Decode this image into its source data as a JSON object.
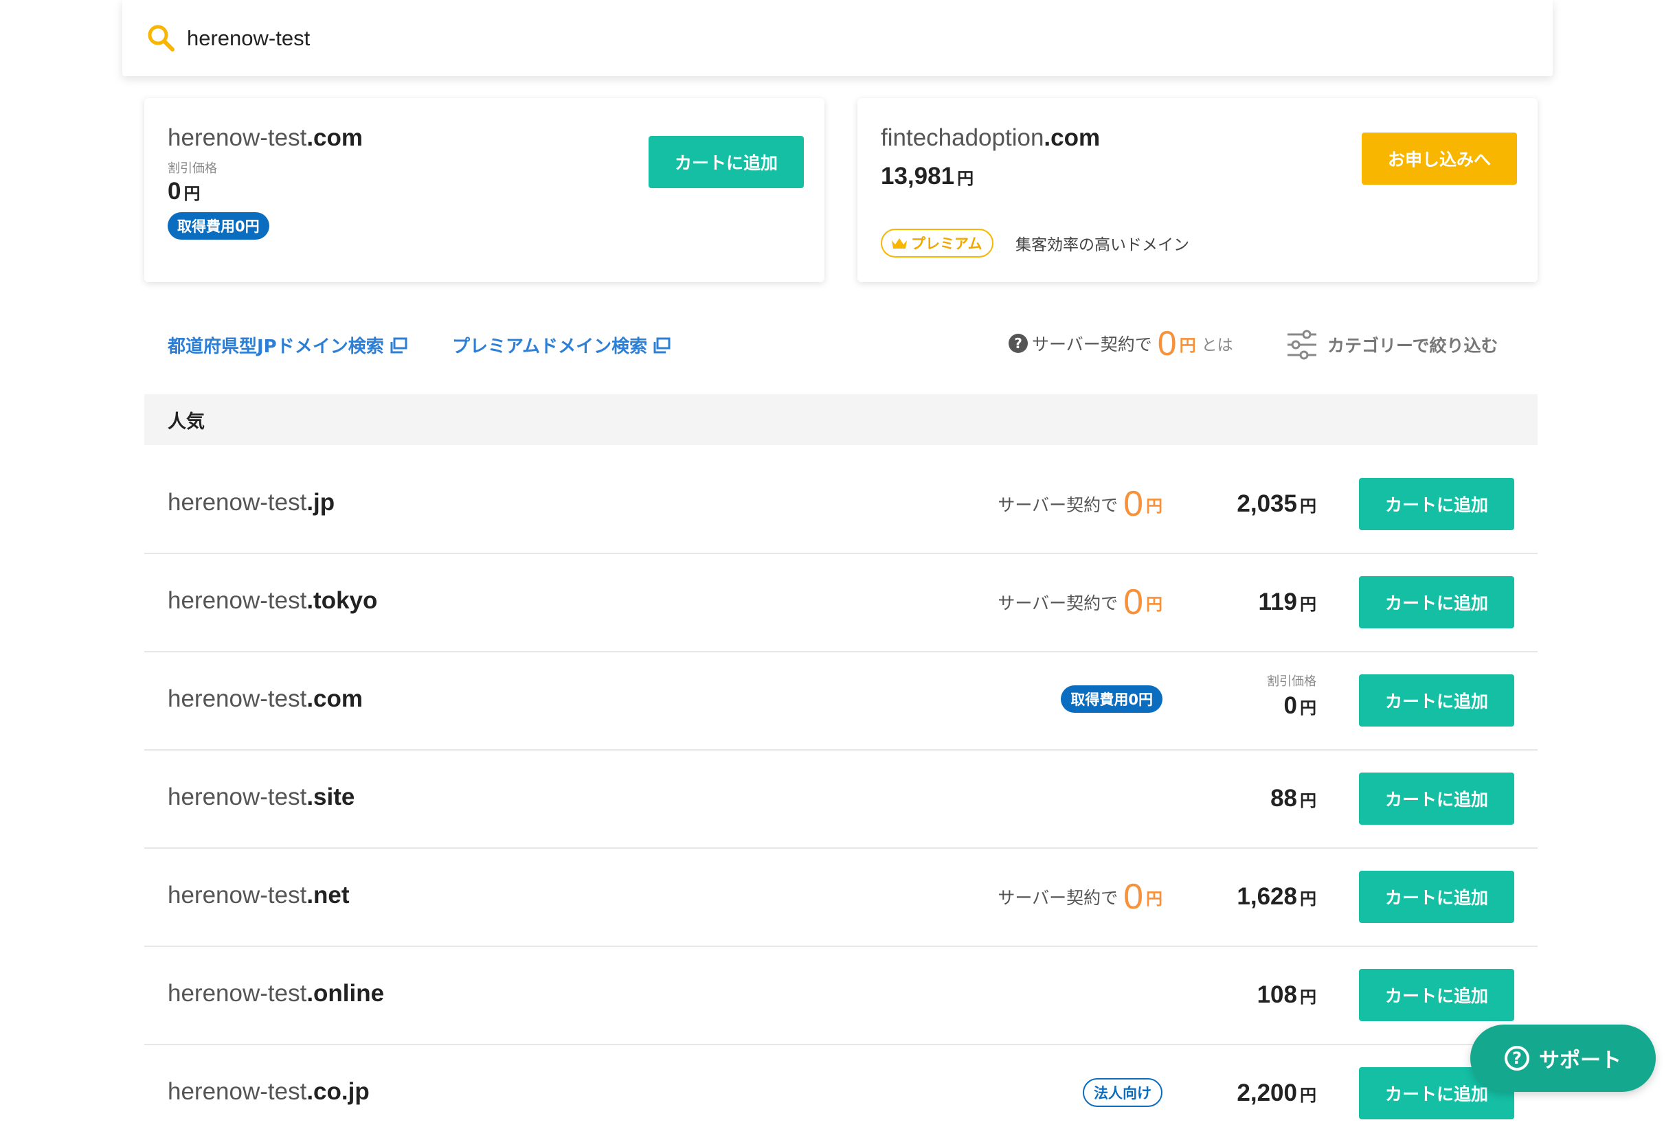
{
  "search": {
    "value": "herenow-test"
  },
  "cards": [
    {
      "domain_name": "herenow-test",
      "domain_tld": ".com",
      "discount_label": "割引価格",
      "price": "0",
      "yen": "円",
      "badge": "取得費用0円",
      "button": "カートに追加"
    },
    {
      "domain_name": "fintechadoption",
      "domain_tld": ".com",
      "price": "13,981",
      "yen": "円",
      "premium_badge": "プレミアム",
      "description": "集客効率の高いドメイン",
      "button": "お申し込みへ"
    }
  ],
  "links": {
    "prefecture": "都道府県型JPドメイン検索",
    "premium": "プレミアムドメイン検索"
  },
  "server_note": {
    "prefix": "サーバー契約で",
    "zero": "0",
    "yen": "円",
    "suffix": "とは"
  },
  "filter": {
    "label": "カテゴリーで絞り込む"
  },
  "section": {
    "title": "人気"
  },
  "rows": [
    {
      "name": "herenow-test",
      "tld": ".jp",
      "promo_prefix": "サーバー契約で",
      "promo_zero": "0",
      "promo_yen": "円",
      "price": "2,035",
      "yen": "円",
      "button": "カートに追加"
    },
    {
      "name": "herenow-test",
      "tld": ".tokyo",
      "promo_prefix": "サーバー契約で",
      "promo_zero": "0",
      "promo_yen": "円",
      "price": "119",
      "yen": "円",
      "button": "カートに追加"
    },
    {
      "name": "herenow-test",
      "tld": ".com",
      "badge": "取得費用0円",
      "discount_label": "割引価格",
      "price": "0",
      "yen": "円",
      "button": "カートに追加"
    },
    {
      "name": "herenow-test",
      "tld": ".site",
      "price": "88",
      "yen": "円",
      "button": "カートに追加"
    },
    {
      "name": "herenow-test",
      "tld": ".net",
      "promo_prefix": "サーバー契約で",
      "promo_zero": "0",
      "promo_yen": "円",
      "price": "1,628",
      "yen": "円",
      "button": "カートに追加"
    },
    {
      "name": "herenow-test",
      "tld": ".online",
      "price": "108",
      "yen": "円",
      "button": "カートに追加"
    },
    {
      "name": "herenow-test",
      "tld": ".co.jp",
      "badge_outline": "法人向け",
      "price": "2,200",
      "yen": "円",
      "button": "カートに追加"
    }
  ],
  "support": {
    "icon": "?",
    "label": "サポート"
  },
  "colors": {
    "teal": "#14bfa4",
    "yellow": "#f8b600",
    "blue": "#0b6dbf",
    "link": "#2d7fd6",
    "orange": "#f7913a"
  }
}
